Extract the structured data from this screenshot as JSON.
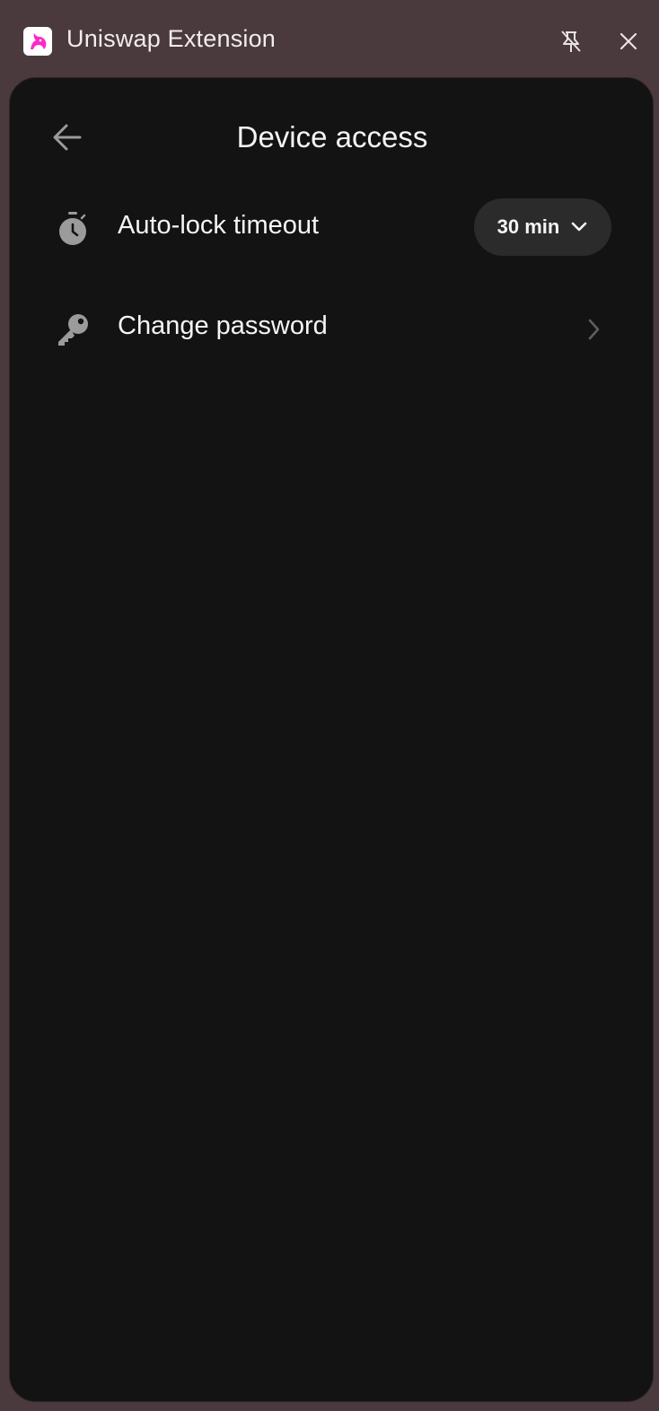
{
  "window": {
    "title": "Uniswap Extension",
    "logo_icon": "uniswap-unicorn-icon",
    "pin_icon": "unpin-icon",
    "close_icon": "close-icon"
  },
  "page": {
    "title": "Device access",
    "back_icon": "arrow-left-icon"
  },
  "settings": [
    {
      "label": "Auto-lock timeout",
      "icon": "stopwatch-icon",
      "control": "dropdown",
      "value": "30 min"
    },
    {
      "label": "Change password",
      "icon": "key-icon",
      "control": "chevron"
    }
  ],
  "colors": {
    "titlebar_bg": "#4a3a3d",
    "panel_bg": "#131313",
    "text": "#f5f5f5",
    "icon_gray": "#9b9b9b",
    "dropdown_bg": "#2b2b2b",
    "brand_pink": "#fc29c8"
  }
}
